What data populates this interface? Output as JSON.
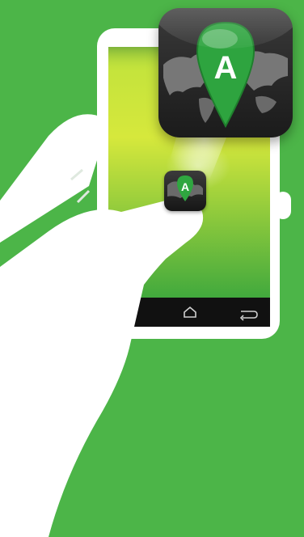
{
  "app_icon": {
    "letter": "A",
    "name": "map-pin-app-icon"
  },
  "colors": {
    "background": "#4cb548",
    "pin_green": "#2e9f3c",
    "screen_green_light": "#d8e83b",
    "screen_green_dark": "#3fa83e",
    "phone_body": "#ffffff",
    "hand": "#ffffff"
  },
  "nav_icons": [
    "home-icon",
    "back-icon"
  ]
}
